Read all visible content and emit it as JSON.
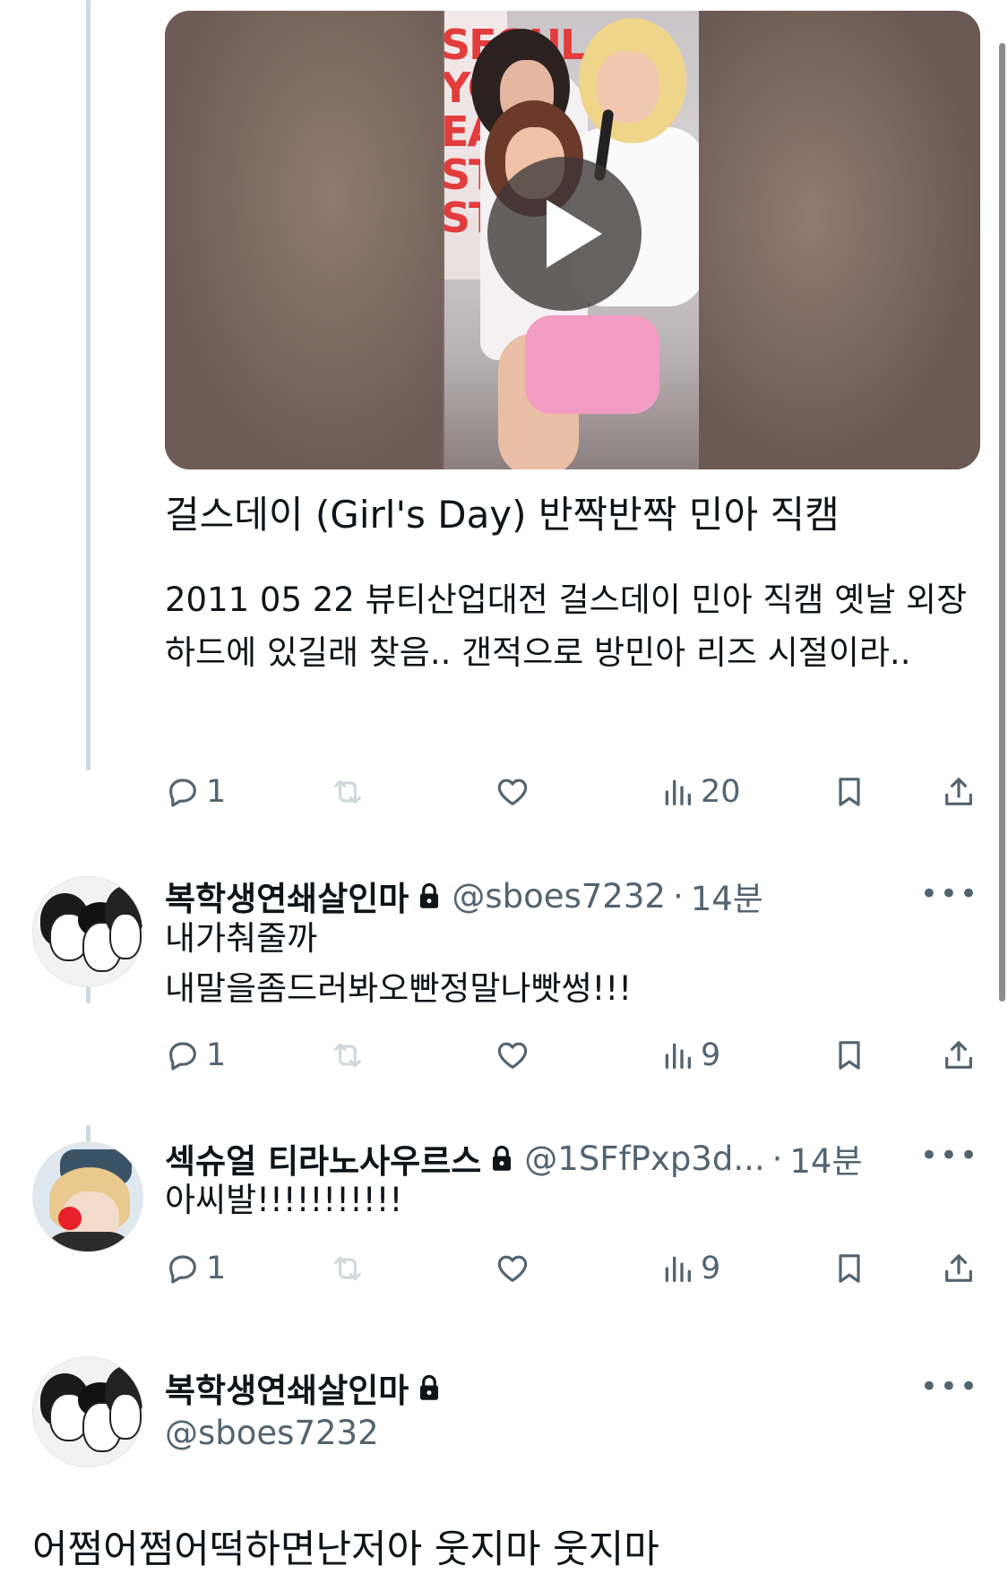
{
  "embed": {
    "title": "걸스데이 (Girl's Day) 반짝반짝 민아 직캠",
    "description": "2011 05 22 뷰티산업대전 걸스데이 민아 직캠 옛날 외장하드에 있길래 찾음.. 갠적으로 방민아 리즈 시절이라..",
    "video_banner_text": "SEOUL\nYO\nEA\nST\nST",
    "play_icon": "play-icon",
    "stats": {
      "replies": "1",
      "views": "20"
    }
  },
  "replies": [
    {
      "display_name": "복학생연쇄살인마",
      "handle": "@sboes7232",
      "time": "14분",
      "lines": [
        "내가춰줄까",
        "내말을좀드러봐오빤정말나빳썽!!!"
      ],
      "stats": {
        "replies": "1",
        "views": "9"
      }
    },
    {
      "display_name": "섹슈얼 티라노사우르스",
      "handle": "@1SFfPxp3d...",
      "time": "14분",
      "lines": [
        "아씨발!!!!!!!!!!!"
      ],
      "stats": {
        "replies": "1",
        "views": "9"
      }
    }
  ],
  "main_post": {
    "display_name": "복학생연쇄살인마",
    "handle": "@sboes7232",
    "text": "어쩜어쩜어떡하면난저아 웃지마 웃지마"
  },
  "separators": {
    "dot": "·",
    "more": "•••"
  },
  "icons": [
    "reply-icon",
    "retweet-icon",
    "like-icon",
    "views-icon",
    "bookmark-icon",
    "share-icon",
    "lock-icon",
    "more-icon"
  ],
  "colors": {
    "text": "#0f1419",
    "secondary": "#536471",
    "thread_line": "#cfd9de",
    "retweet_disabled": "#cfd9de"
  }
}
